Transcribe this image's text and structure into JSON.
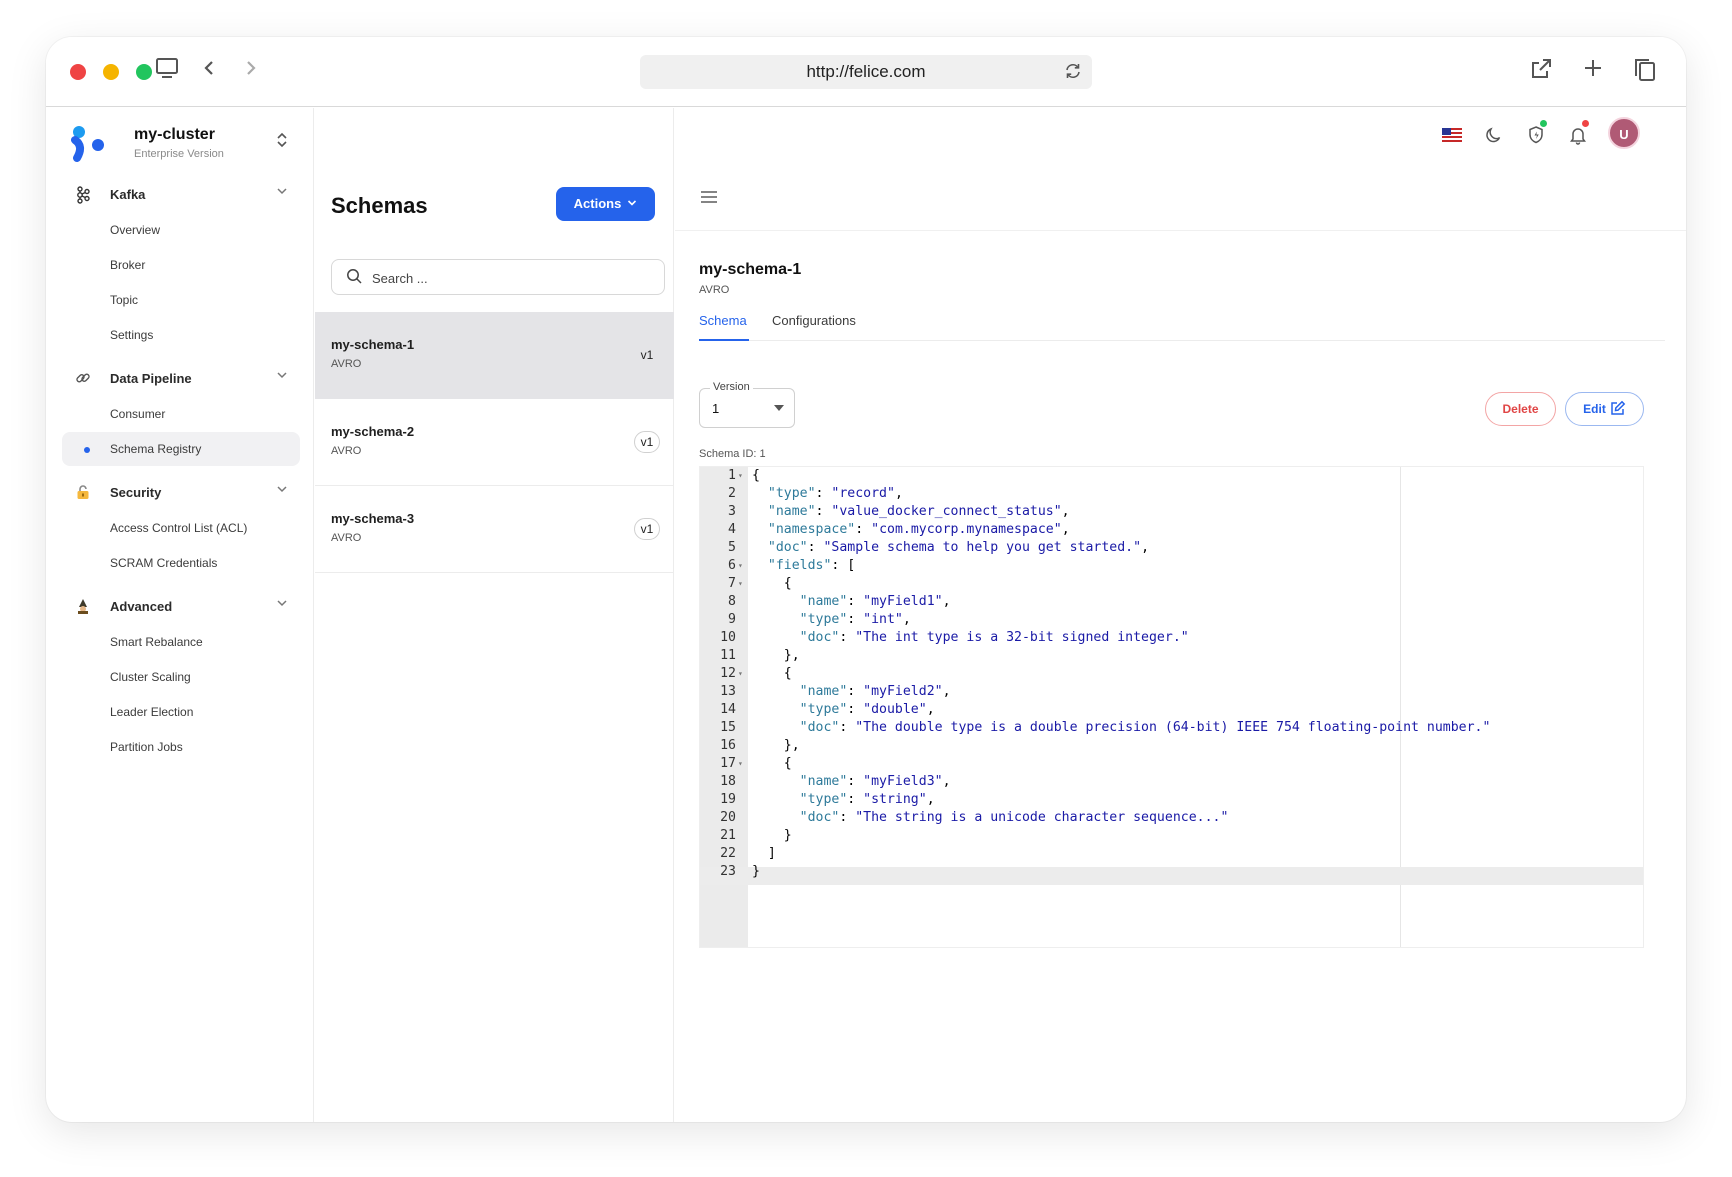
{
  "browser": {
    "url": "http://felice.com"
  },
  "brand": {
    "name": "my-cluster",
    "subtitle": "Enterprise Version"
  },
  "sidebar": {
    "groups": [
      {
        "label": "Kafka",
        "icon": "kafka-icon",
        "items": [
          "Overview",
          "Broker",
          "Topic",
          "Settings"
        ]
      },
      {
        "label": "Data Pipeline",
        "icon": "link-icon",
        "items": [
          "Consumer",
          "Schema Registry"
        ]
      },
      {
        "label": "Security",
        "icon": "lock-icon",
        "items": [
          "Access Control List (ACL)",
          "SCRAM Credentials"
        ]
      },
      {
        "label": "Advanced",
        "icon": "wizard-icon",
        "items": [
          "Smart Rebalance",
          "Cluster Scaling",
          "Leader Election",
          "Partition Jobs"
        ]
      }
    ],
    "active_item": "Schema Registry"
  },
  "schemas_panel": {
    "title": "Schemas",
    "actions_label": "Actions",
    "search_placeholder": "Search ...",
    "items": [
      {
        "name": "my-schema-1",
        "type": "AVRO",
        "version": "v1"
      },
      {
        "name": "my-schema-2",
        "type": "AVRO",
        "version": "v1"
      },
      {
        "name": "my-schema-3",
        "type": "AVRO",
        "version": "v1"
      }
    ]
  },
  "topbar": {
    "avatar_initial": "U",
    "colors": {
      "shield_dot": "#22c55e",
      "bell_dot": "#ef4444",
      "avatar_bg": "#b05a75"
    }
  },
  "detail": {
    "title": "my-schema-1",
    "subtitle": "AVRO",
    "tabs": [
      "Schema",
      "Configurations"
    ],
    "active_tab": "Schema",
    "version_label": "Version",
    "version_value": "1",
    "delete_label": "Delete",
    "edit_label": "Edit",
    "schema_id_text": "Schema ID: 1",
    "code_lines": [
      "{",
      "  \"type\": \"record\",",
      "  \"name\": \"value_docker_connect_status\",",
      "  \"namespace\": \"com.mycorp.mynamespace\",",
      "  \"doc\": \"Sample schema to help you get started.\",",
      "  \"fields\": [",
      "    {",
      "      \"name\": \"myField1\",",
      "      \"type\": \"int\",",
      "      \"doc\": \"The int type is a 32-bit signed integer.\"",
      "    },",
      "    {",
      "      \"name\": \"myField2\",",
      "      \"type\": \"double\",",
      "      \"doc\": \"The double type is a double precision (64-bit) IEEE 754 floating-point number.\"",
      "    },",
      "    {",
      "      \"name\": \"myField3\",",
      "      \"type\": \"string\",",
      "      \"doc\": \"The string is a unicode character sequence...\"",
      "    }",
      "  ]",
      "}"
    ],
    "fold_lines": [
      1,
      6,
      7,
      12,
      17
    ]
  },
  "colors": {
    "accent": "#2563eb",
    "danger": "#e04545"
  }
}
